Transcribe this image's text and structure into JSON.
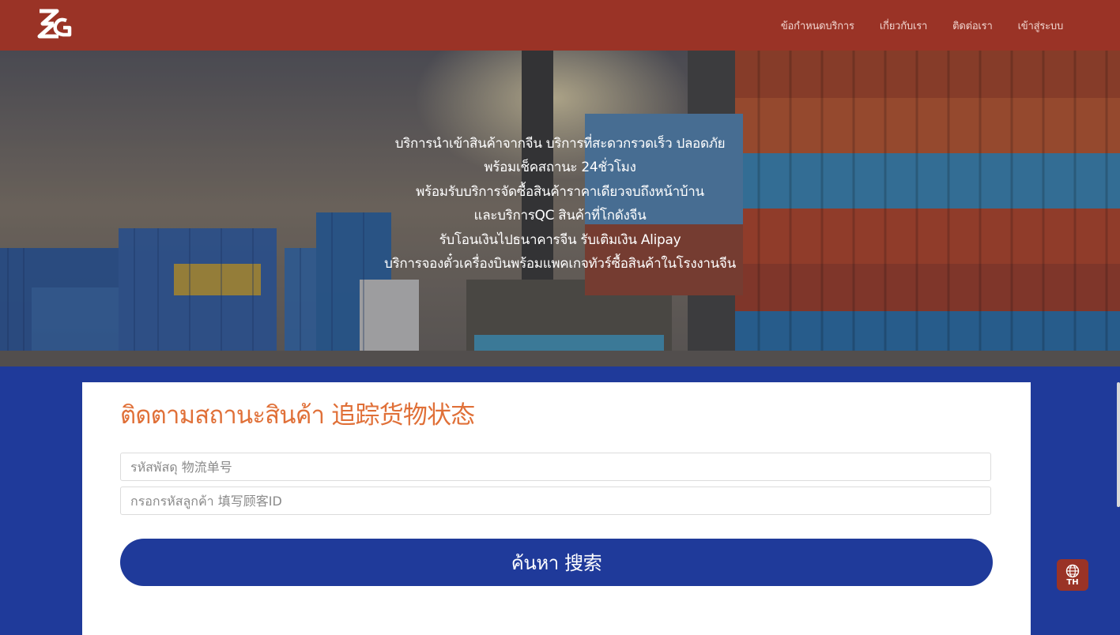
{
  "header": {
    "logo_icon": "zg-logo-icon",
    "nav": [
      {
        "label": "ข้อกำหนดบริการ"
      },
      {
        "label": "เกี่ยวกับเรา"
      },
      {
        "label": "ติดต่อเรา"
      },
      {
        "label": "เข้าสู่ระบบ"
      }
    ]
  },
  "hero": {
    "lines": [
      "บริการนำเข้าสินค้าจากจีน บริการที่สะดวกรวดเร็ว ปลอดภัย",
      "พร้อมเช็คสถานะ 24ชั่วโมง",
      "พร้อมรับบริการจัดซื้อสินค้าราคาเดียวจบถึงหน้าบ้าน",
      "และบริการQC สินค้าที่โกดังจีน",
      "รับโอนเงินไปธนาคารจีน รับเติมเงิน Alipay",
      "บริการจองตั๋วเครื่องบินพร้อมแพคเกจทัวร์ซื้อสินค้าในโรงงานจีน"
    ]
  },
  "tracking": {
    "title": "ติดตามสถานะสินค้า  追踪货物状态",
    "parcel_placeholder": "รหัสพัสดุ 物流单号",
    "customer_placeholder": "กรอกรหัสลูกค้า 填写顾客ID",
    "search_label": "ค้นหา 搜索"
  },
  "language": {
    "icon": "globe-icon",
    "label": "TH"
  },
  "colors": {
    "header": "#9a3326",
    "accent_orange": "#e07038",
    "primary_blue": "#1f3a9a"
  }
}
